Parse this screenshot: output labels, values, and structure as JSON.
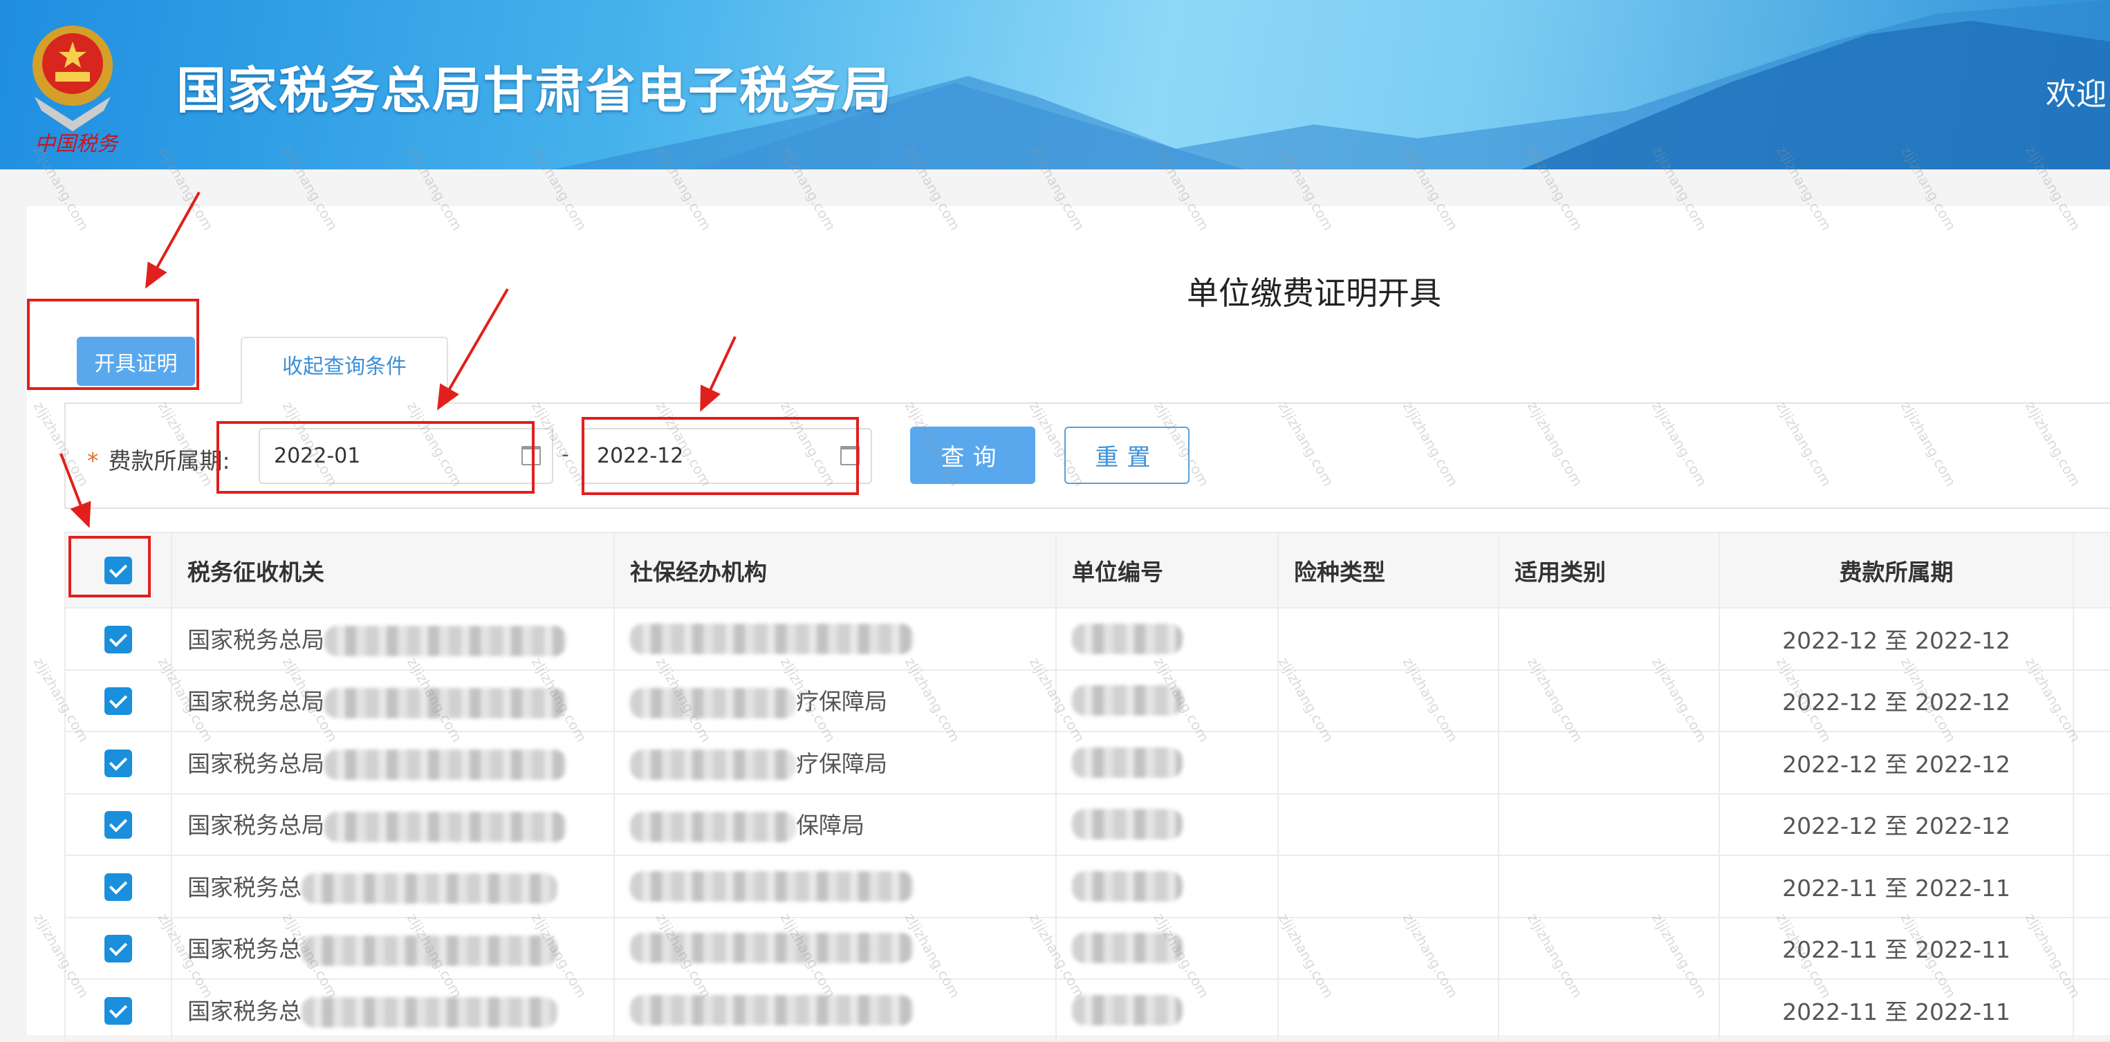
{
  "header": {
    "site_title": "国家税务总局甘肃省电子税务局",
    "welcome": "欢迎",
    "logo_text": "中国税务"
  },
  "page_title": "单位缴费证明开具",
  "buttons": {
    "issue": "开具证明",
    "collapse_tab": "收起查询条件",
    "query": "查询",
    "reset": "重置"
  },
  "filter": {
    "label": "费款所属期:",
    "required_mark": "*",
    "start": "2022-01",
    "end": "2022-12",
    "separator": "-"
  },
  "table": {
    "columns": [
      "税务征收机关",
      "社保经办机构",
      "单位编号",
      "险种类型",
      "适用类别",
      "费款所属期"
    ],
    "rows": [
      {
        "tax_office": "国家税务总局",
        "social_office": "",
        "unit_no": "",
        "insurance_type": "",
        "category": "",
        "period": "2022-12 至 2022-12",
        "checked": true
      },
      {
        "tax_office": "国家税务总局",
        "social_office": "疗保障局",
        "unit_no": "",
        "insurance_type": "",
        "category": "",
        "period": "2022-12 至 2022-12",
        "checked": true
      },
      {
        "tax_office": "国家税务总局",
        "social_office": "疗保障局",
        "unit_no": "",
        "insurance_type": "",
        "category": "",
        "period": "2022-12 至 2022-12",
        "checked": true
      },
      {
        "tax_office": "国家税务总局",
        "social_office": "保障局",
        "unit_no": "",
        "insurance_type": "",
        "category": "",
        "period": "2022-12 至 2022-12",
        "checked": true
      },
      {
        "tax_office": "国家税务总",
        "social_office": "",
        "unit_no": "",
        "insurance_type": "",
        "category": "",
        "period": "2022-11 至 2022-11",
        "checked": true
      },
      {
        "tax_office": "国家税务总",
        "social_office": "",
        "unit_no": "",
        "insurance_type": "",
        "category": "",
        "period": "2022-11 至 2022-11",
        "checked": true
      },
      {
        "tax_office": "国家税务总",
        "social_office": "",
        "unit_no": "",
        "insurance_type": "",
        "category": "",
        "period": "2022-11 至 2022-11",
        "checked": true
      }
    ],
    "select_all_checked": true
  },
  "watermark": "zljizhang.com",
  "colors": {
    "primary": "#59a8ee",
    "checkbox": "#1a8fdc",
    "annotation": "#e0201c",
    "required": "#e0712f"
  }
}
